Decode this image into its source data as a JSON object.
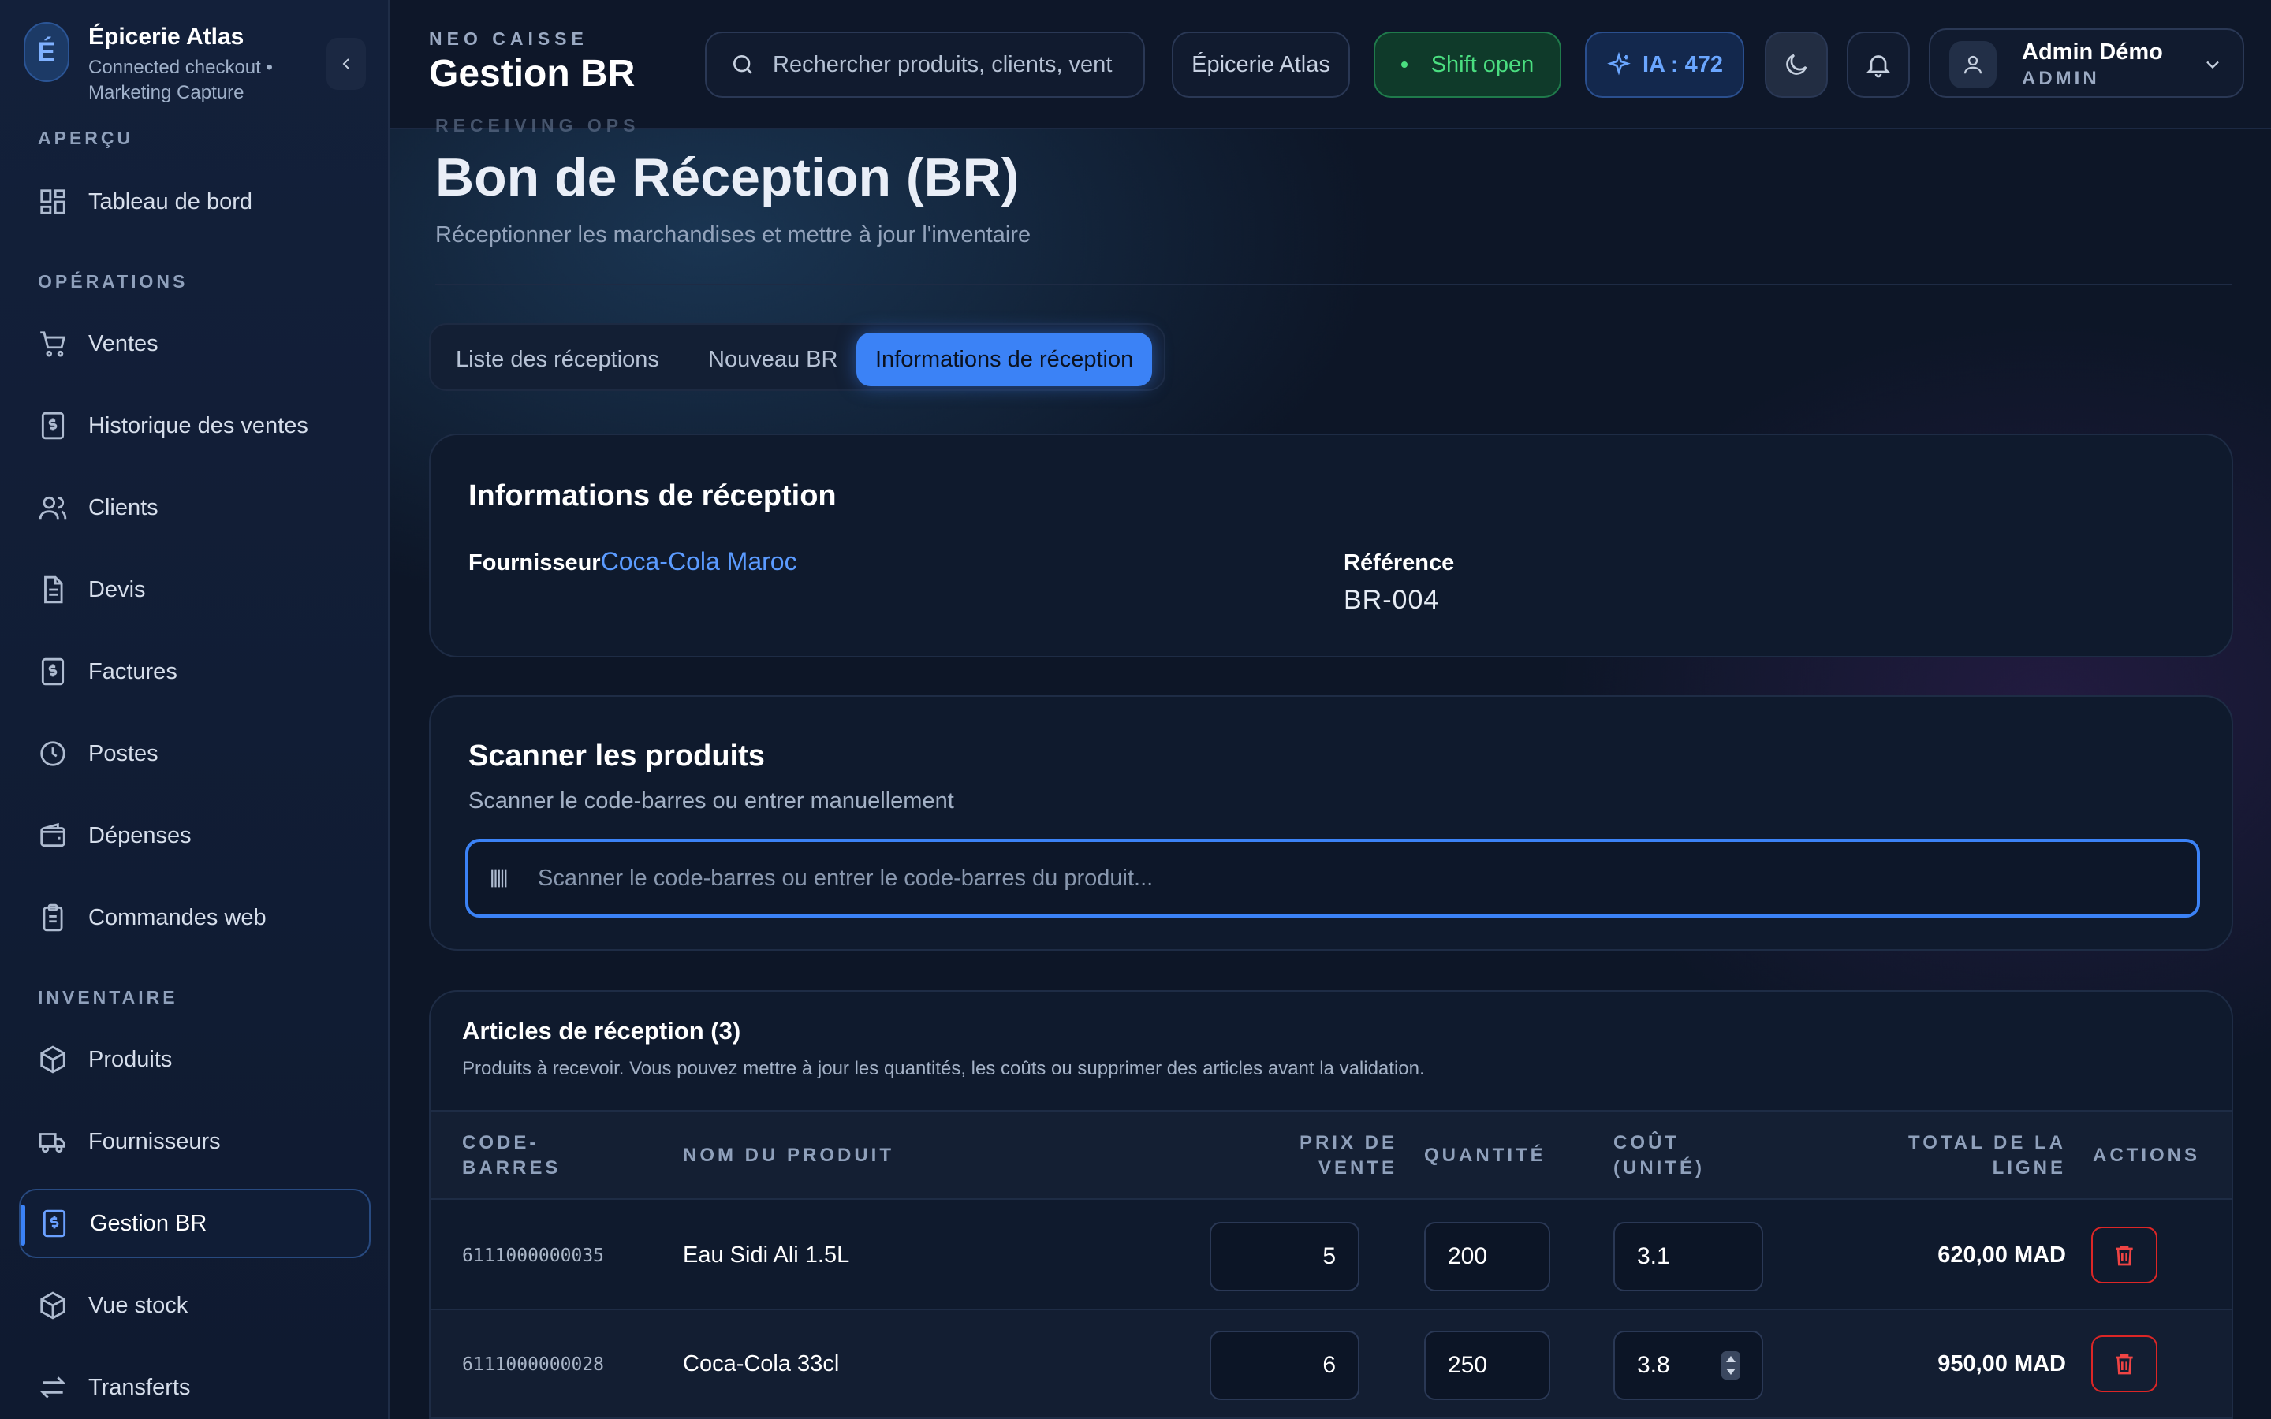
{
  "sidebar": {
    "brand_initial": "É",
    "brand_name": "Épicerie Atlas",
    "brand_sub": "Connected checkout • Marketing Capture",
    "sections": {
      "apercu": "APERÇU",
      "operations": "OPÉRATIONS",
      "inventaire": "INVENTAIRE"
    },
    "items": [
      {
        "label": "Tableau de bord",
        "icon": "grid-icon"
      },
      {
        "label": "Ventes",
        "icon": "cart-icon"
      },
      {
        "label": "Historique des ventes",
        "icon": "dollar-doc-icon"
      },
      {
        "label": "Clients",
        "icon": "users-icon"
      },
      {
        "label": "Devis",
        "icon": "document-icon"
      },
      {
        "label": "Factures",
        "icon": "dollar-doc-icon"
      },
      {
        "label": "Postes",
        "icon": "clock-icon"
      },
      {
        "label": "Dépenses",
        "icon": "wallet-icon"
      },
      {
        "label": "Commandes web",
        "icon": "clipboard-icon"
      },
      {
        "label": "Produits",
        "icon": "box-icon"
      },
      {
        "label": "Fournisseurs",
        "icon": "truck-icon"
      },
      {
        "label": "Gestion BR",
        "icon": "dollar-doc-icon",
        "active": true
      },
      {
        "label": "Vue stock",
        "icon": "box-icon"
      },
      {
        "label": "Transferts",
        "icon": "transfer-icon"
      }
    ]
  },
  "header": {
    "eyebrow": "NEO CAISSE",
    "title": "Gestion BR",
    "search_placeholder": "Rechercher produits, clients, vent",
    "store": "Épicerie Atlas",
    "shift": "Shift open",
    "ia": "IA : 472",
    "user_name": "Admin Démo",
    "user_role": "ADMIN"
  },
  "page": {
    "ghost_label": "RECEIVING OPS",
    "title": "Bon de Réception (BR)",
    "subtitle": "Réceptionner les marchandises et mettre à jour l'inventaire"
  },
  "tabs": [
    "Liste des réceptions",
    "Nouveau BR",
    "Informations de réception"
  ],
  "info": {
    "title": "Informations de réception",
    "supplier_label": "Fournisseur",
    "supplier_value": "Coca-Cola Maroc",
    "reference_label": "Référence",
    "reference_value": "BR-004"
  },
  "scan": {
    "title": "Scanner les produits",
    "subtitle": "Scanner le code-barres ou entrer manuellement",
    "placeholder": "Scanner le code-barres ou entrer le code-barres du produit..."
  },
  "items_table": {
    "title": "Articles de réception (3)",
    "subtitle": "Produits à recevoir. Vous pouvez mettre à jour les quantités, les coûts ou supprimer des articles avant la validation.",
    "headers": {
      "barcode_1": "CODE-",
      "barcode_2": "BARRES",
      "name": "NOM DU PRODUIT",
      "price_1": "PRIX DE",
      "price_2": "VENTE",
      "qty": "QUANTITÉ",
      "cost_1": "COÛT",
      "cost_2": "(UNITÉ)",
      "total_1": "TOTAL DE LA",
      "total_2": "LIGNE",
      "actions": "ACTIONS"
    },
    "rows": [
      {
        "barcode": "6111000000035",
        "name": "Eau Sidi Ali 1.5L",
        "price": "5",
        "qty": "200",
        "cost": "3.1",
        "total": "620,00 MAD"
      },
      {
        "barcode": "6111000000028",
        "name": "Coca-Cola 33cl",
        "price": "6",
        "qty": "250",
        "cost": "3.8",
        "total": "950,00 MAD"
      }
    ]
  },
  "colors": {
    "accent": "#3b82f6",
    "success": "#4ade80",
    "danger": "#ef4444",
    "background": "#0d1627"
  }
}
